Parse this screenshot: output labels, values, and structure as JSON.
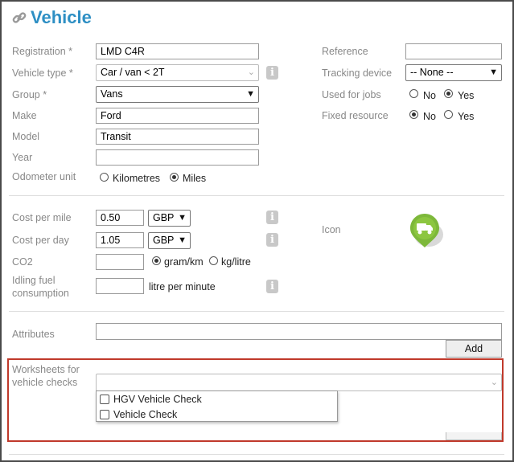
{
  "header": {
    "title": "Vehicle",
    "icon": "link-icon",
    "accent": "#2e8fc4"
  },
  "left": {
    "registration": {
      "label": "Registration *",
      "value": "LMD C4R"
    },
    "vehicle_type": {
      "label": "Vehicle type *",
      "value": "Car / van < 2T"
    },
    "group": {
      "label": "Group *",
      "value": "Vans"
    },
    "make": {
      "label": "Make",
      "value": "Ford"
    },
    "model": {
      "label": "Model",
      "value": "Transit"
    },
    "year": {
      "label": "Year",
      "value": ""
    },
    "odometer": {
      "label": "Odometer unit",
      "options": [
        "Kilometres",
        "Miles"
      ],
      "selected": "Miles"
    }
  },
  "right": {
    "reference": {
      "label": "Reference",
      "value": ""
    },
    "tracking": {
      "label": "Tracking device",
      "value": "-- None --"
    },
    "used_for_jobs": {
      "label": "Used for jobs",
      "options": [
        "No",
        "Yes"
      ],
      "selected": "Yes"
    },
    "fixed_resource": {
      "label": "Fixed resource",
      "options": [
        "No",
        "Yes"
      ],
      "selected": "No"
    }
  },
  "costs": {
    "per_mile": {
      "label": "Cost per mile",
      "value": "0.50",
      "currency": "GBP"
    },
    "per_day": {
      "label": "Cost per day",
      "value": "1.05",
      "currency": "GBP"
    },
    "co2": {
      "label": "CO2",
      "value": "",
      "options": [
        "gram/km",
        "kg/litre"
      ],
      "selected": "gram/km"
    },
    "idling": {
      "label_line1": "Idling fuel",
      "label_line2": "consumption",
      "value": "",
      "unit": "litre per minute"
    },
    "icon_label": "Icon",
    "vehicle_icon": "truck-icon",
    "icon_color": "#7db83a"
  },
  "attributes": {
    "label": "Attributes",
    "value": "",
    "add_label": "Add"
  },
  "worksheets": {
    "label_line1": "Worksheets for",
    "label_line2": "vehicle checks",
    "options": [
      "HGV Vehicle Check",
      "Vehicle Check"
    ],
    "highlight_color": "#c0392b"
  }
}
